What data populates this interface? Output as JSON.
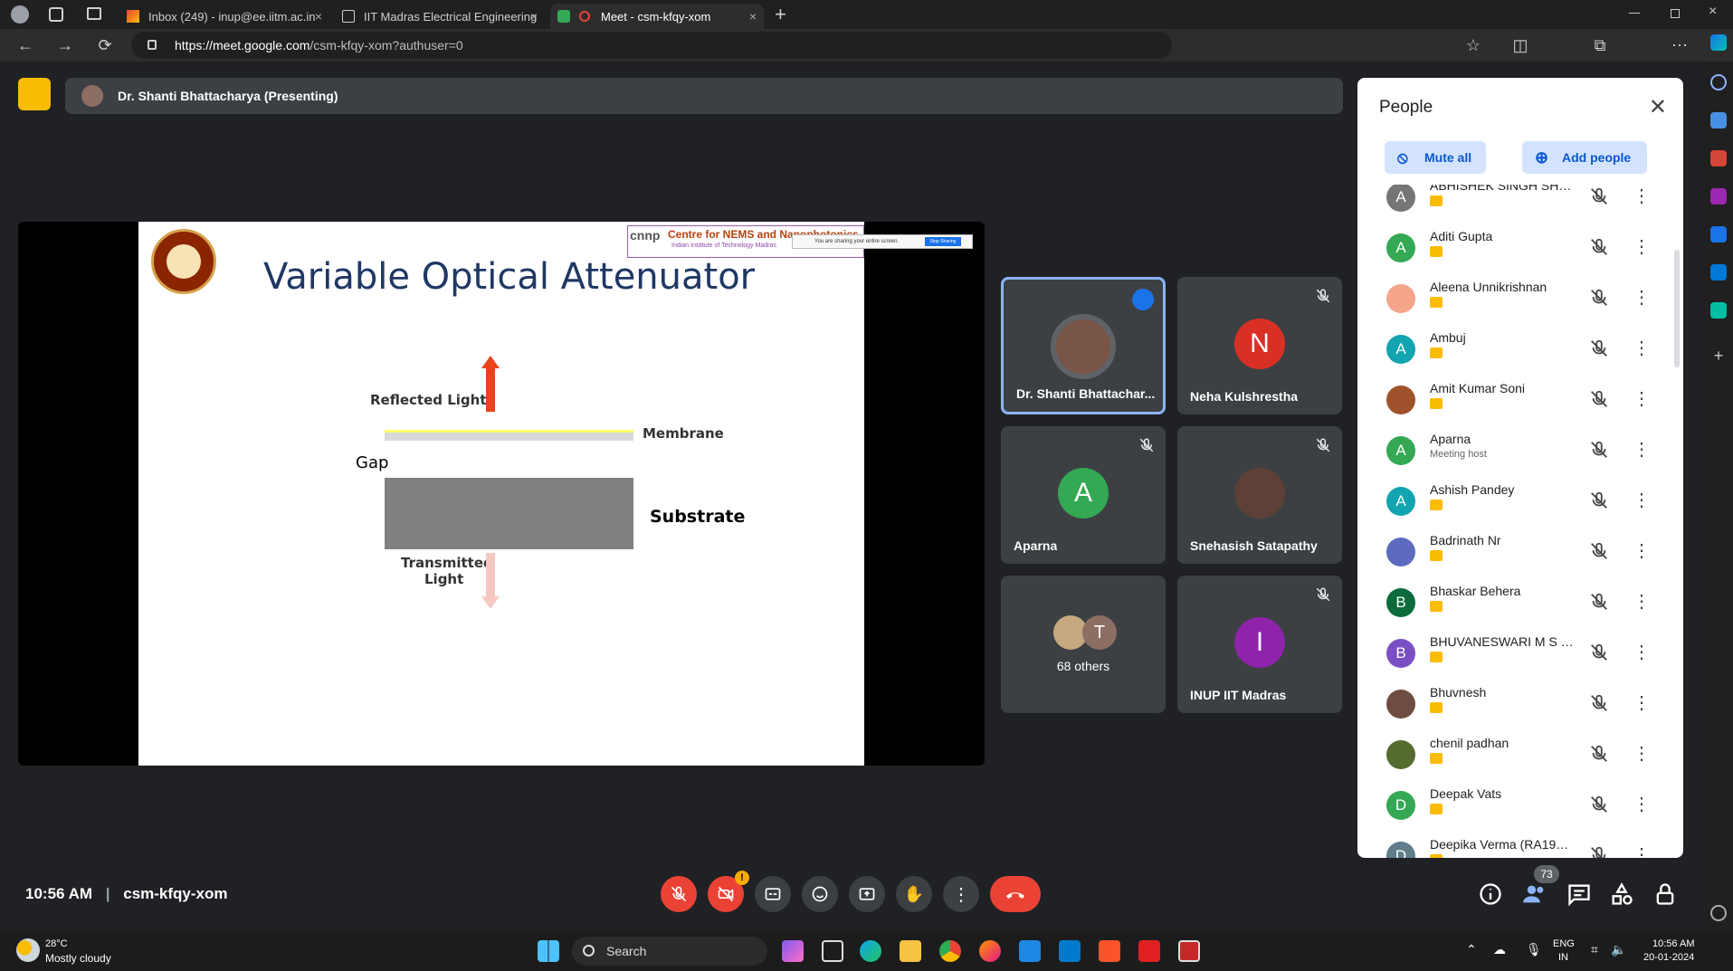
{
  "browser": {
    "tabs": [
      {
        "label": "Inbox (249) - inup@ee.iitm.ac.in"
      },
      {
        "label": "IIT Madras Electrical Engineering"
      },
      {
        "label": "Meet - csm-kfqy-xom"
      }
    ],
    "url_host": "https://meet.google.com",
    "url_path": "/csm-kfqy-xom?authuser=0"
  },
  "meet": {
    "presenting_label": "Dr. Shanti Bhattacharya (Presenting)",
    "meeting_code": "csm-kfqy-xom",
    "time": "10:56 AM",
    "people_count": "73"
  },
  "slide": {
    "title": "Variable Optical Attenuator",
    "org_name": "Centre for NEMS and Nanophotonics",
    "org_sub": "Indian Institute of Technology Madras",
    "org_logo": "cnnp",
    "share_notice": "You are sharing your entire screen.",
    "share_stop": "Stop Sharing",
    "labels": {
      "reflected": "Reflected Light",
      "membrane": "Membrane",
      "gap": "Gap",
      "substrate": "Substrate",
      "transmitted_1": "Transmitted",
      "transmitted_2": "Light"
    }
  },
  "tiles": [
    {
      "name": "Dr. Shanti Bhattachar...",
      "initial": "",
      "color": "#795548"
    },
    {
      "name": "Neha Kulshrestha",
      "initial": "N",
      "color": "#d93025"
    },
    {
      "name": "Aparna",
      "initial": "A",
      "color": "#34a853"
    },
    {
      "name": "Snehasish Satapathy",
      "initial": "",
      "color": "#5d4037"
    },
    {
      "name": "68 others",
      "initial": "T",
      "color": "#8d6e63"
    },
    {
      "name": "INUP IIT Madras",
      "initial": "I",
      "color": "#8e24aa"
    }
  ],
  "people": {
    "title": "People",
    "mute_all": "Mute all",
    "add_people": "Add people",
    "list": [
      {
        "name": "ABHISHEK SINGH SHEK...",
        "initial": "A",
        "color": "#757575",
        "sub": ""
      },
      {
        "name": "Aditi Gupta",
        "initial": "A",
        "color": "#34a853",
        "sub": ""
      },
      {
        "name": "Aleena Unnikrishnan",
        "initial": "",
        "color": "#f4a58a",
        "sub": ""
      },
      {
        "name": "Ambuj",
        "initial": "A",
        "color": "#12a4af",
        "sub": ""
      },
      {
        "name": "Amit Kumar Soni",
        "initial": "",
        "color": "#a0522d",
        "sub": ""
      },
      {
        "name": "Aparna",
        "initial": "A",
        "color": "#34a853",
        "sub": "Meeting host"
      },
      {
        "name": "Ashish Pandey",
        "initial": "A",
        "color": "#12a4af",
        "sub": ""
      },
      {
        "name": "Badrinath Nr",
        "initial": "",
        "color": "#5c6bc0",
        "sub": ""
      },
      {
        "name": "Bhaskar Behera",
        "initial": "B",
        "color": "#0b6b3a",
        "sub": ""
      },
      {
        "name": "BHUVANESWARI M S (R...",
        "initial": "B",
        "color": "#7b4fc4",
        "sub": ""
      },
      {
        "name": "Bhuvnesh",
        "initial": "",
        "color": "#6d4c41",
        "sub": ""
      },
      {
        "name": "chenil padhan",
        "initial": "",
        "color": "#556b2f",
        "sub": ""
      },
      {
        "name": "Deepak Vats",
        "initial": "D",
        "color": "#34a853",
        "sub": ""
      },
      {
        "name": "Deepika Verma (RA1913...",
        "initial": "D",
        "color": "#607d8b",
        "sub": ""
      }
    ]
  },
  "taskbar": {
    "weather_temp": "28°C",
    "weather_desc": "Mostly cloudy",
    "search": "Search",
    "lang1": "ENG",
    "lang2": "IN",
    "time": "10:56 AM",
    "date": "20-01-2024"
  },
  "colors": {
    "accent": "#8ab4f8",
    "danger": "#ea4335",
    "present": "#fbbc04"
  }
}
